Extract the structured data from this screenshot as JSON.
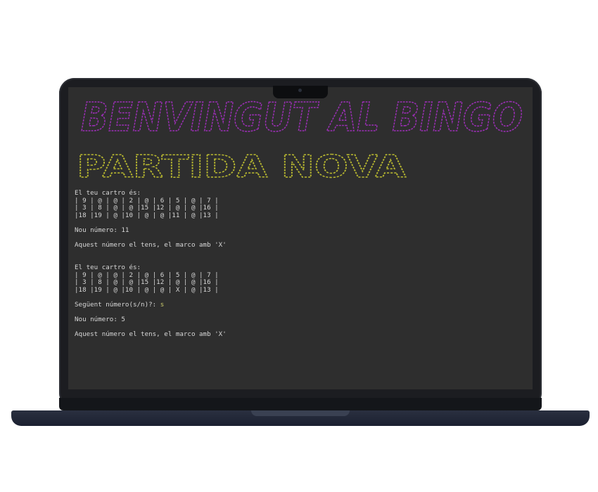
{
  "banner": {
    "title": "BENVINGUT AL BINGO",
    "subtitle": "PARTIDA NOVA",
    "title_color": "#9b2fb5",
    "subtitle_color": "#b8b830"
  },
  "terminal": {
    "lines": [
      {
        "text": "El teu cartro és:"
      },
      {
        "text": "| 9 | @ | @ | 2 | @ | 6 | 5 | @ | 7 |"
      },
      {
        "text": "| 3 | 8 | @ | @ |15 |12 | @ | @ |16 |"
      },
      {
        "text": "|18 |19 | @ |10 | @ | @ |11 | @ |13 |"
      },
      {
        "text": ""
      },
      {
        "text": "Nou número: 11"
      },
      {
        "text": ""
      },
      {
        "text": "Aquest número el tens, el marco amb 'X'"
      },
      {
        "text": ""
      },
      {
        "text": ""
      },
      {
        "text": "El teu cartro és:"
      },
      {
        "text": "| 9 | @ | @ | 2 | @ | 6 | 5 | @ | 7 |"
      },
      {
        "text": "| 3 | 8 | @ | @ |15 |12 | @ | @ |16 |"
      },
      {
        "text": "|18 |19 | @ |10 | @ | @ | X | @ |13 |"
      },
      {
        "text": ""
      },
      {
        "text": "Següent número(s/n)?: ",
        "answer": "s"
      },
      {
        "text": ""
      },
      {
        "text": "Nou número: 5"
      },
      {
        "text": ""
      },
      {
        "text": "Aquest número el tens, el marco amb 'X'"
      }
    ]
  },
  "colors": {
    "screen_bg": "#2e2e2e",
    "text": "#d6d6d6",
    "input": "#c8c86a"
  }
}
